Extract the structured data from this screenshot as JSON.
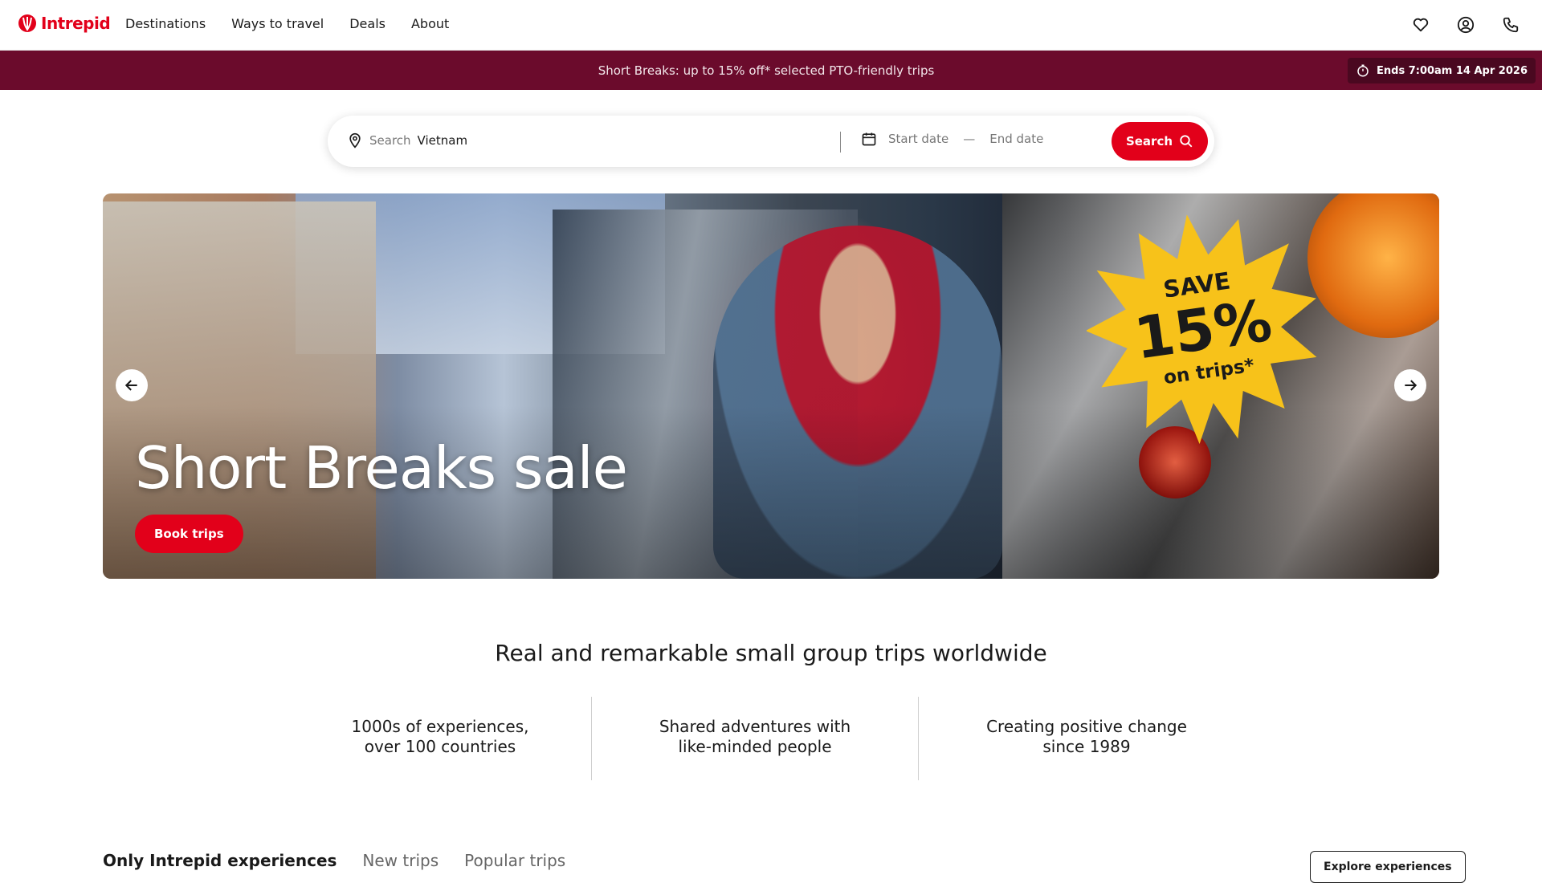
{
  "header": {
    "logo_text": "Intrepid",
    "nav": [
      "Destinations",
      "Ways to travel",
      "Deals",
      "About"
    ],
    "icons": [
      "heart-icon",
      "user-icon",
      "phone-icon"
    ]
  },
  "promo": {
    "text": "Short Breaks: up to 15% off* selected PTO-friendly trips",
    "countdown": "Ends 7:00am 14 Apr 2026",
    "background": "#6b0b2c"
  },
  "search": {
    "prefix": "Search",
    "value": "Vietnam",
    "start_placeholder": "Start date",
    "end_placeholder": "End date",
    "dash": "—",
    "button_label": "Search"
  },
  "hero": {
    "title": "Short Breaks sale",
    "button_label": "Book trips",
    "badge_line1": "SAVE",
    "badge_line2": "15%",
    "badge_line3": "on trips*"
  },
  "tagline": "Real and remarkable small group trips worldwide",
  "features": [
    {
      "line1": "1000s of experiences,",
      "line2": "over 100 countries"
    },
    {
      "line1": "Shared adventures with",
      "line2": "like-minded people"
    },
    {
      "line1": "Creating positive change",
      "line2": "since 1989"
    }
  ],
  "tabs": [
    "Only Intrepid experiences",
    "New trips",
    "Popular trips"
  ],
  "explore_label": "Explore experiences",
  "colors": {
    "brand": "#e2001a",
    "banner": "#6b0b2c",
    "badge": "#f7c21a"
  }
}
